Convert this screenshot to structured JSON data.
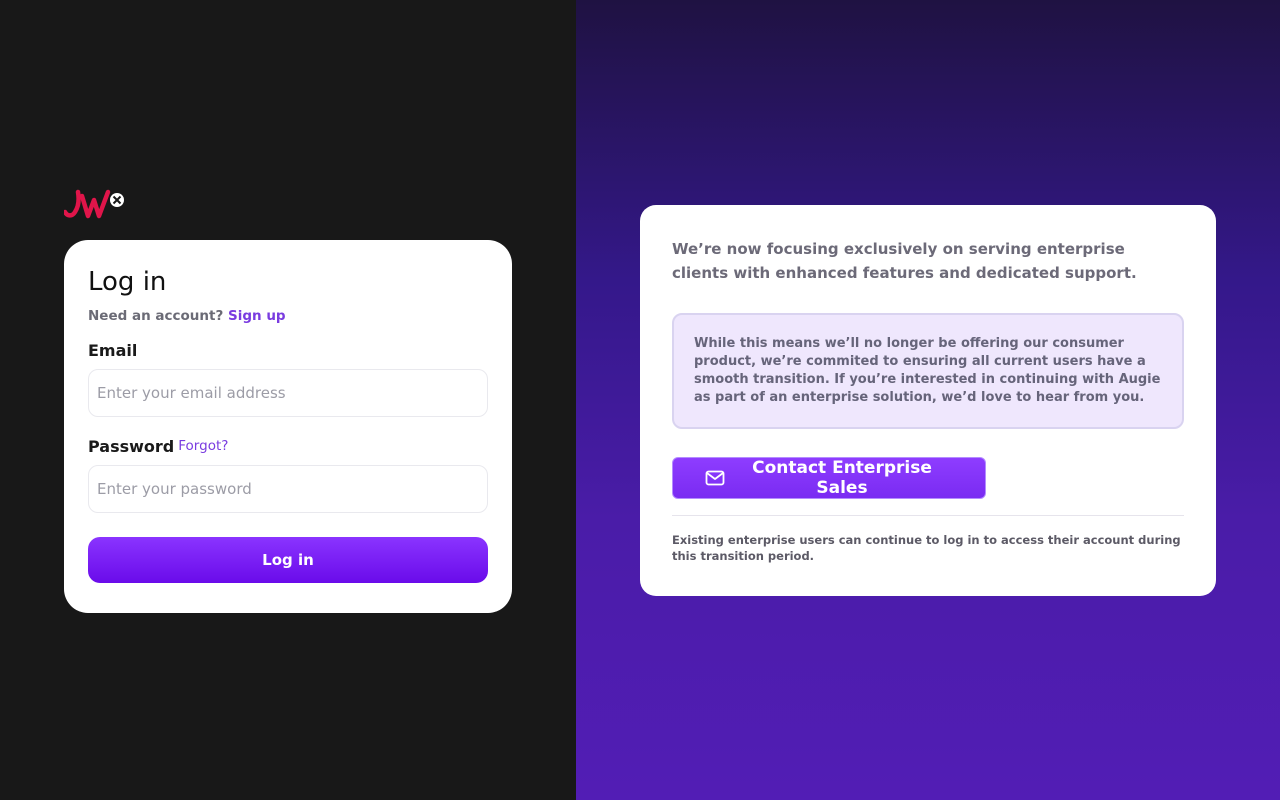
{
  "brand": {
    "logo_text": "JW",
    "logo_color": "#e0154a"
  },
  "login": {
    "title": "Log in",
    "signup_prompt": "Need an account?",
    "signup_link": "Sign up",
    "email_label": "Email",
    "email_placeholder": "Enter your email address",
    "password_label": "Password",
    "forgot_link": "Forgot?",
    "password_placeholder": "Enter your password",
    "submit_label": "Log in"
  },
  "notice": {
    "lead": "We’re now focusing exclusively on serving enterprise clients with enhanced features and dedicated support.",
    "box_text": "While this means we’ll no longer be offering our consumer product, we’re commited to ensuring all current users have a smooth transition. If you’re interested in continuing with Augie as part of an enterprise solution, we’d love to hear from you.",
    "contact_button": "Contact Enterprise Sales",
    "contact_icon": "mail-icon",
    "footnote": "Existing enterprise users can continue to log in to access their account during this transition period."
  },
  "colors": {
    "accent": "#7a3ce0",
    "button_gradient_top": "#8a34ff",
    "button_gradient_bottom": "#6a0bea",
    "left_bg": "#181818",
    "right_bg_top": "#1f1242",
    "right_bg_bottom": "#521db5"
  }
}
